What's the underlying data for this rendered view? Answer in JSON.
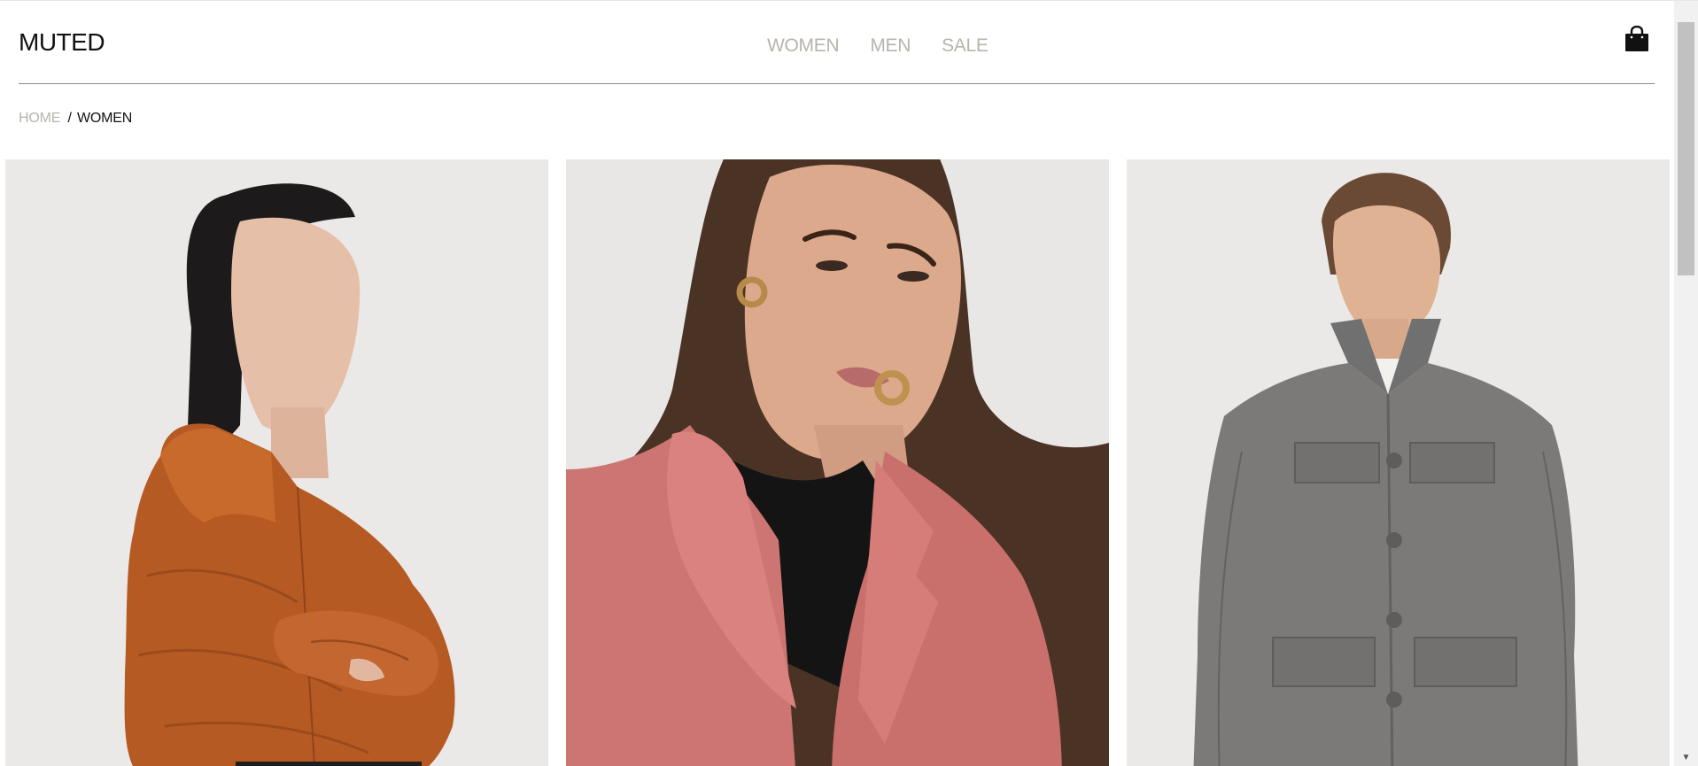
{
  "brand": {
    "name": "MUTED"
  },
  "nav": {
    "items": [
      "WOMEN",
      "MEN",
      "SALE"
    ]
  },
  "header": {
    "cart_icon": "shopping-bag-icon"
  },
  "breadcrumb": {
    "home": "HOME",
    "separator": "/",
    "current": "WOMEN"
  },
  "colors": {
    "nav_text": "#b8b3ad",
    "text": "#111111",
    "product_background": "#ebe9e8"
  },
  "products": [
    {
      "image": "woman-in-rust-orange-puffer-jacket"
    },
    {
      "image": "woman-in-pink-wool-coat"
    },
    {
      "image": "woman-in-grey-wool-shirt-jacket"
    }
  ]
}
